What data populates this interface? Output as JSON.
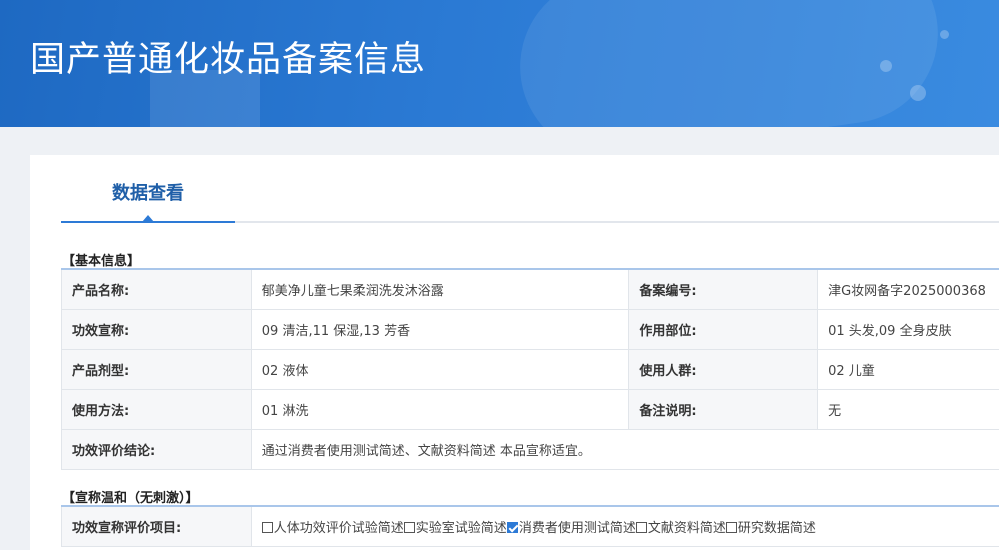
{
  "header": {
    "title": "国产普通化妆品备案信息"
  },
  "tabs": [
    {
      "label": "数据查看"
    }
  ],
  "basic": {
    "section_title": "【基本信息】",
    "rows": [
      {
        "label1": "产品名称:",
        "value1": "郁美净儿童七果柔润洗发沐浴露",
        "label2": "备案编号:",
        "value2": "津G妆网备字2025000368"
      },
      {
        "label1": "功效宣称:",
        "value1": "09 清洁,11 保湿,13 芳香",
        "label2": "作用部位:",
        "value2": "01 头发,09 全身皮肤"
      },
      {
        "label1": "产品剂型:",
        "value1": "02 液体",
        "label2": "使用人群:",
        "value2": "02 儿童"
      },
      {
        "label1": "使用方法:",
        "value1": "01 淋洗",
        "label2": "备注说明:",
        "value2": "无"
      }
    ],
    "conclusion_label": "功效评价结论:",
    "conclusion_value": "通过消费者使用测试简述、文献资料简述 本品宣称适宜。"
  },
  "claim": {
    "section_title": "【宣称温和（无刺激）】",
    "label": "功效宣称评价项目:",
    "items": [
      {
        "label": "人体功效评价试验简述",
        "checked": false
      },
      {
        "label": "实验室试验简述",
        "checked": false
      },
      {
        "label": "消费者使用测试简述",
        "checked": true
      },
      {
        "label": "文献资料简述",
        "checked": false
      },
      {
        "label": "研究数据简述",
        "checked": false
      }
    ]
  }
}
